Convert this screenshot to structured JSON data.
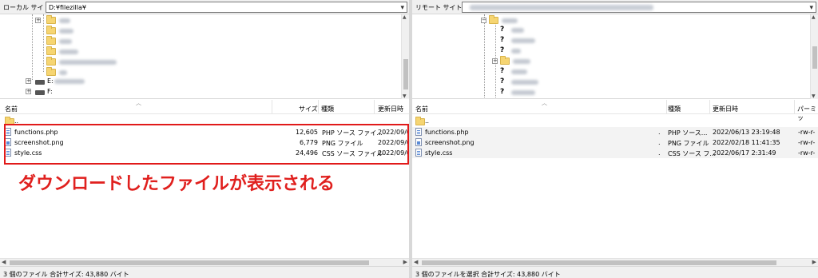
{
  "left": {
    "site_label": "ローカル サイト:",
    "site_path": "D:¥filezilla¥",
    "tree": {
      "drives": [
        "E:",
        "F:"
      ]
    },
    "columns": [
      "名前",
      "サイズ",
      "種類",
      "更新日時"
    ],
    "parent_dir": "..",
    "files": [
      {
        "name": "functions.php",
        "size": "12,605",
        "type": "PHP ソース ファイ...",
        "date": "2022/09/0",
        "icon": "php-file-icon"
      },
      {
        "name": "screenshot.png",
        "size": "6,779",
        "type": "PNG ファイル",
        "date": "2022/09/0",
        "icon": "png-file-icon"
      },
      {
        "name": "style.css",
        "size": "24,496",
        "type": "CSS ソース ファイル",
        "date": "2022/09/0",
        "icon": "css-file-icon"
      }
    ],
    "status": "3 個のファイル 合計サイズ: 43,880 バイト"
  },
  "right": {
    "site_label": "リモート サイト:",
    "columns": [
      "名前",
      "種類",
      "更新日時",
      "パーミッ"
    ],
    "parent_dir": "..",
    "files": [
      {
        "name": "functions.php",
        "size": ".",
        "type": "PHP ソース...",
        "date": "2022/06/13 23:19:48",
        "perm": "-rw-r-",
        "icon": "php-file-icon"
      },
      {
        "name": "screenshot.png",
        "size": ".",
        "type": "PNG ファイル",
        "date": "2022/02/18 11:41:35",
        "perm": "-rw-r-",
        "icon": "png-file-icon"
      },
      {
        "name": "style.css",
        "size": ".",
        "type": "CSS ソース フ...",
        "date": "2022/06/17 2:31:49",
        "perm": "-rw-r-",
        "icon": "css-file-icon"
      }
    ],
    "status": "3 個のファイルを選択 合計サイズ: 43,880 バイト"
  },
  "annotation": "ダウンロードしたファイルが表示される",
  "colors": {
    "highlight": "#e11a1a",
    "annotation": "#e0201e",
    "folder": "#f6d572"
  }
}
